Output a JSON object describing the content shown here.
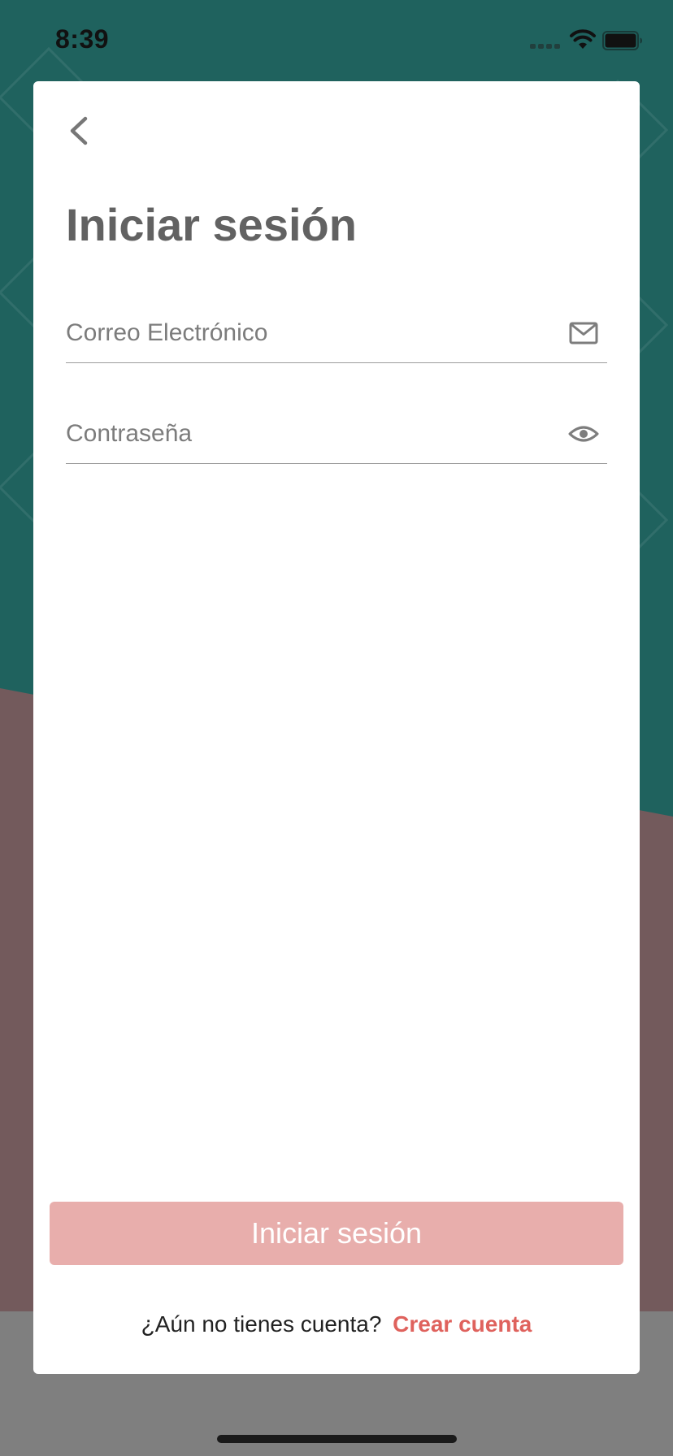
{
  "status_bar": {
    "time": "8:39",
    "icons": [
      "cellular-signal-icon",
      "wifi-icon",
      "battery-icon"
    ]
  },
  "login": {
    "back_icon": "chevron-left-icon",
    "title": "Iniciar sesión",
    "email": {
      "placeholder": "Correo Electrónico",
      "value": "",
      "icon": "envelope-icon"
    },
    "password": {
      "placeholder": "Contraseña",
      "value": "",
      "icon": "eye-icon"
    },
    "submit_label": "Iniciar sesión",
    "signup_prompt": "¿Aún no tienes cuenta?",
    "signup_link": "Crear cuenta"
  },
  "colors": {
    "background_top": "#1f625e",
    "background_bottom": "#735a5c",
    "button_disabled": "#e8aeac",
    "link": "#df625d",
    "title": "#626262"
  }
}
